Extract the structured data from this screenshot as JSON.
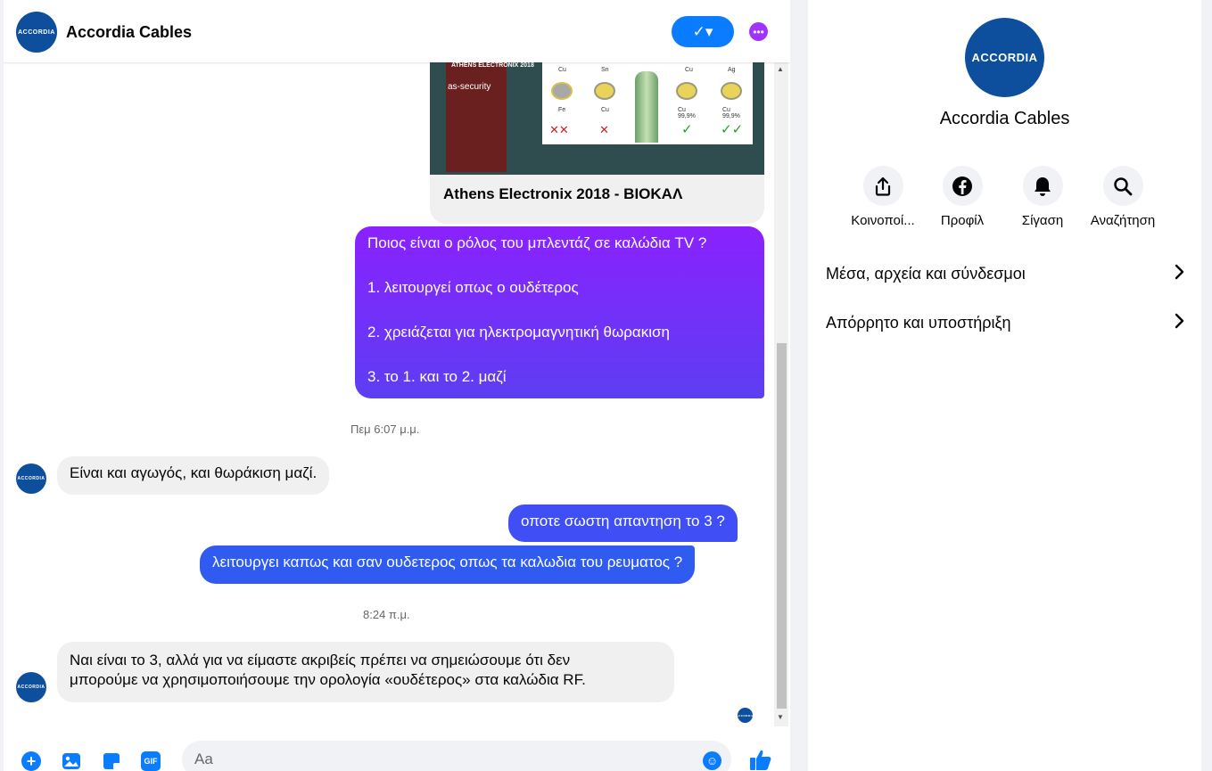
{
  "contact": {
    "name": "Accordia Cables",
    "avatar_text": "ACCORDIA"
  },
  "header": {
    "check_label": "✓▾",
    "more_label": "•••"
  },
  "link_card": {
    "title": "Athens Electronix 2018 - ΒΙΟΚΑΛ",
    "thumb_banner": "ATHENS ELECTRONIX 2018",
    "thumb_security": "as-security",
    "slide_labels_top": [
      "Cu",
      "Sn",
      "Cu",
      "Ag"
    ],
    "slide_labels_bottom": [
      "Fe",
      "Cu",
      "Cu 99,9%",
      "Cu 99,9%"
    ],
    "slide_marks": [
      "✕✕",
      "✕",
      "✓",
      "✓✓"
    ]
  },
  "messages": {
    "question_lines": [
      "Ποιος είναι ο ρόλος του μπλεντάζ σε καλώδια TV ?",
      "1. λειτουργεί οπως ο ουδέτερος",
      "2. χρειάζεται για ηλεκτρομαγνητική θωρακιση",
      "3. το 1. και το 2. μαζί"
    ],
    "time_1": "Πεμ 6:07 μ.μ.",
    "reply_1": "Είναι και αγωγός, και θωράκιση μαζί.",
    "out_2": "οποτε σωστη απαντηση το 3 ?",
    "out_3": "λειτουργει καπως και σαν ουδετερος οπως τα καλωδια του ρευματος ?",
    "time_2": "8:24 π.μ.",
    "reply_2_line1": "Ναι είναι το 3, αλλά για να είμαστε ακριβείς πρέπει να σημειώσουμε ότι δεν",
    "reply_2_line2": "μπορούμε να χρησιμοποιήσουμε την ορολογία «ουδέτερος» στα καλώδια RF."
  },
  "composer": {
    "placeholder": "Aa",
    "plus_label": "+",
    "gif_label": "GIF"
  },
  "side": {
    "actions": [
      {
        "label": "Κοινοποί...",
        "icon": "share-icon"
      },
      {
        "label": "Προφίλ",
        "icon": "facebook-icon"
      },
      {
        "label": "Σίγαση",
        "icon": "bell-icon"
      },
      {
        "label": "Αναζήτηση",
        "icon": "search-icon"
      }
    ],
    "rows": [
      {
        "label": "Μέσα, αρχεία και σύνδεσμοι"
      },
      {
        "label": "Απόρρητο και υποστήριξη"
      }
    ]
  },
  "colors": {
    "accent": "#0a7cff",
    "outgoing_top": "#8a22ff",
    "outgoing_bottom": "#2f5bf0",
    "brand": "#0d4f9c"
  }
}
